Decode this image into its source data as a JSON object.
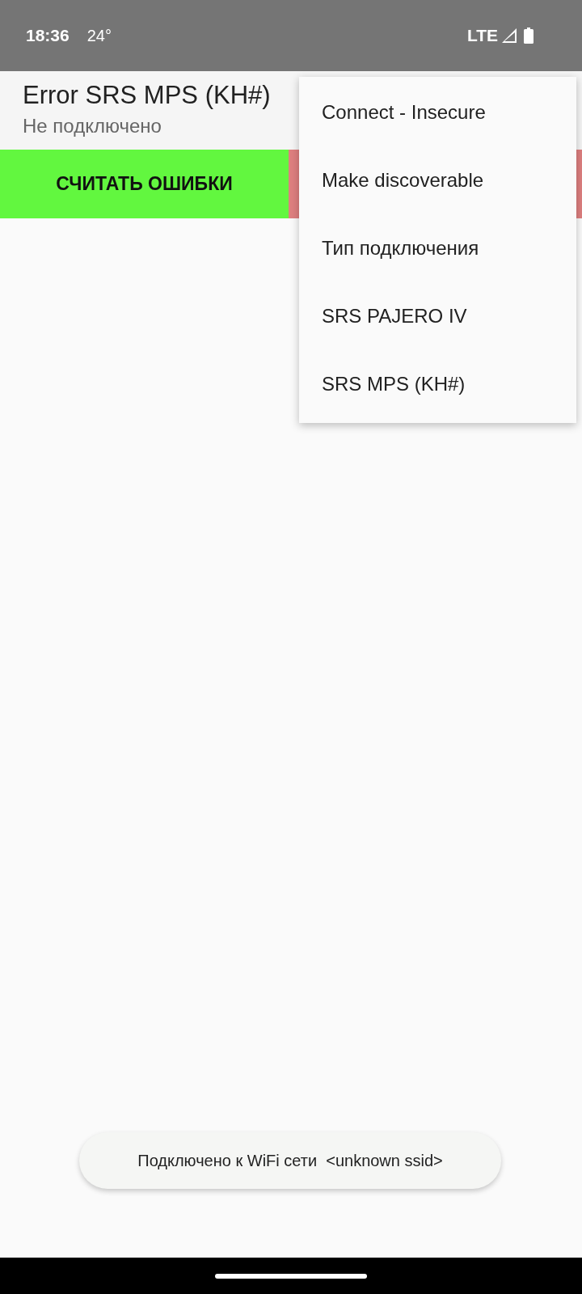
{
  "status_bar": {
    "time": "18:36",
    "temperature": "24°",
    "network": "LTE"
  },
  "app_bar": {
    "title": "Error SRS MPS (KH#)",
    "subtitle": "Не подключено"
  },
  "buttons": [
    {
      "label": "СЧИТАТЬ ОШИБКИ",
      "color": "#62f73f"
    },
    {
      "color": "#de7f7f"
    }
  ],
  "menu": {
    "items": [
      "Connect - Insecure",
      "Make discoverable",
      "Тип подключения",
      "SRS PAJERO IV",
      "SRS MPS (KH#)"
    ]
  },
  "toast": {
    "text": "Подключено к WiFi сети  <unknown ssid>"
  }
}
